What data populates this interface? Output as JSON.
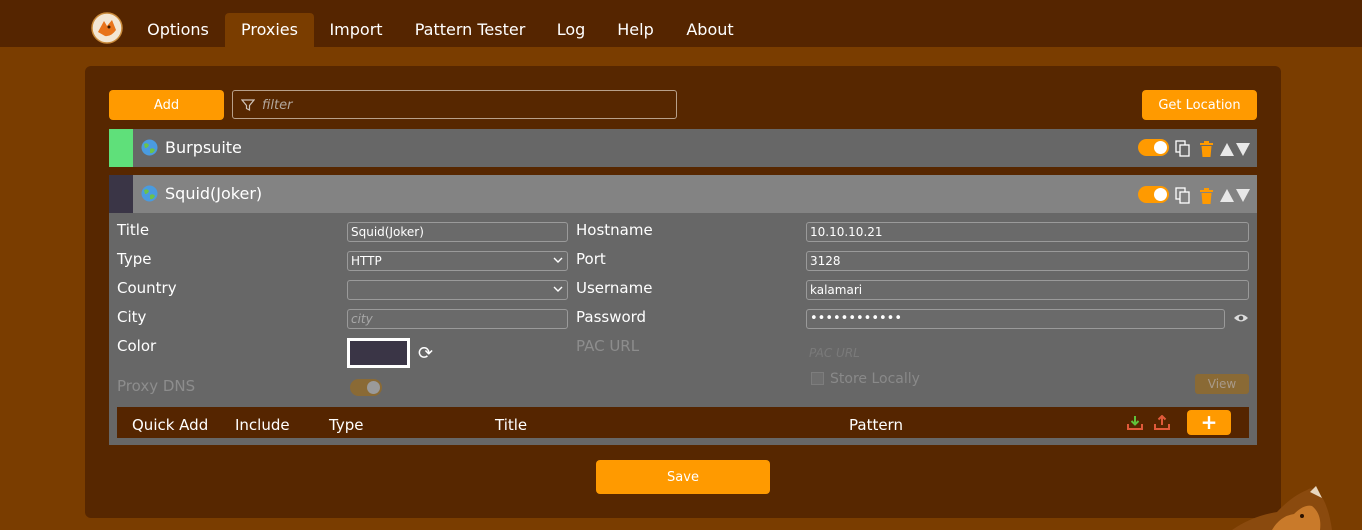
{
  "nav": {
    "tabs": [
      {
        "label": "Options"
      },
      {
        "label": "Proxies"
      },
      {
        "label": "Import"
      },
      {
        "label": "Pattern Tester"
      },
      {
        "label": "Log"
      },
      {
        "label": "Help"
      },
      {
        "label": "About"
      }
    ],
    "active_tab": "Proxies"
  },
  "toolbar": {
    "add_label": "Add",
    "filter_placeholder": "filter",
    "get_location_label": "Get Location"
  },
  "proxies": [
    {
      "title": "Burpsuite",
      "color": "#5fe07a",
      "enabled": true,
      "icon": "globe-icon"
    },
    {
      "title": "Squid(Joker)",
      "color": "#3a3546",
      "enabled": true,
      "icon": "globe-icon"
    }
  ],
  "detail": {
    "title_label": "Title",
    "title_value": "Squid(Joker)",
    "type_label": "Type",
    "type_value": "HTTP",
    "country_label": "Country",
    "country_value": "",
    "city_label": "City",
    "city_placeholder": "city",
    "color_label": "Color",
    "color_value": "#3a3546",
    "proxy_dns_label": "Proxy DNS",
    "hostname_label": "Hostname",
    "hostname_value": "10.10.10.21",
    "port_label": "Port",
    "port_value": "3128",
    "username_label": "Username",
    "username_value": "kalamari",
    "password_label": "Password",
    "password_value": "••••••••••••",
    "pac_url_label": "PAC URL",
    "pac_url_placeholder": "PAC URL",
    "store_locally_label": "Store Locally",
    "view_label": "View"
  },
  "patterns": {
    "headers": [
      "Quick Add",
      "Include",
      "Type",
      "Title",
      "Pattern"
    ],
    "add_label": "+"
  },
  "save_label": "Save",
  "colors": {
    "accent": "#ff9a00",
    "background": "#7a3d00",
    "nav": "#552500"
  }
}
